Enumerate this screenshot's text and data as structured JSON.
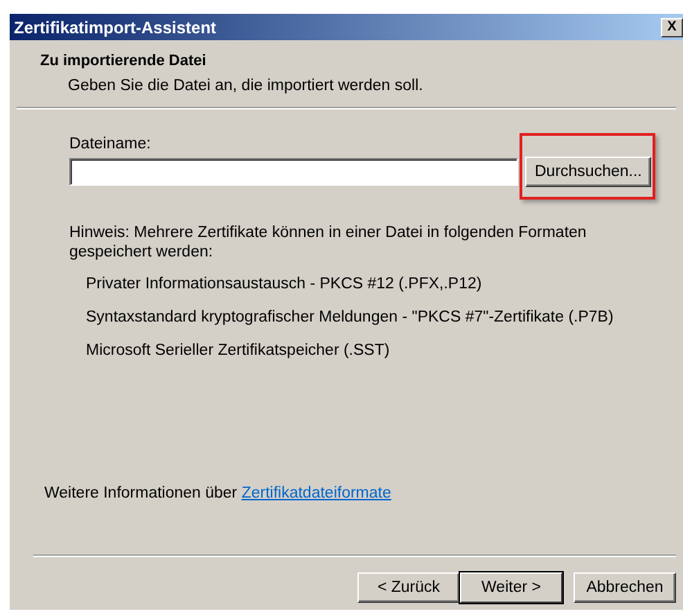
{
  "window": {
    "title": "Zertifikatimport-Assistent",
    "close": "X"
  },
  "header": {
    "title": "Zu importierende Datei",
    "subtitle": "Geben Sie die Datei an, die importiert werden soll."
  },
  "file_field": {
    "label": "Dateiname:",
    "browse_button": "Durchsuchen...",
    "highlighted": true
  },
  "hint": "Hinweis: Mehrere Zertifikate können in einer Datei in folgenden Formaten gespeichert werden:",
  "formats": [
    "Privater Informationsaustausch - PKCS #12 (.PFX,.P12)",
    "Syntaxstandard kryptografischer Meldungen - \"PKCS #7\"-Zertifikate (.P7B)",
    "Microsoft Serieller Zertifikatspeicher (.SST)"
  ],
  "more_info": {
    "text": "Weitere Informationen über",
    "link": "Zertifikatdateiformate"
  },
  "buttons": [
    {
      "label": "< Zurück",
      "default": false
    },
    {
      "label": "Weiter >",
      "default": true
    },
    {
      "label": "Abbrechen",
      "default": false
    }
  ]
}
